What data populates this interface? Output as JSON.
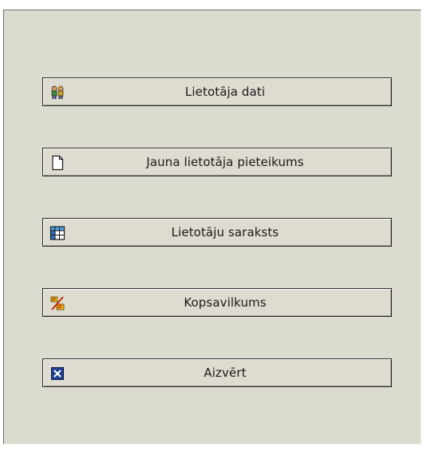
{
  "buttons": [
    {
      "label": "Lietotāja dati",
      "icon": "users-icon"
    },
    {
      "label": "Jauna lietotāja pieteikums",
      "icon": "new-document-icon"
    },
    {
      "label": "Lietotāju saraksts",
      "icon": "table-icon"
    },
    {
      "label": "Kopsavilkums",
      "icon": "summary-icon"
    },
    {
      "label": "Aizvērt",
      "icon": "close-icon"
    }
  ],
  "colors": {
    "panel_background": "#dcdbcf",
    "button_background": "#dedcd1",
    "close_icon_blue": "#1f3f8f"
  }
}
